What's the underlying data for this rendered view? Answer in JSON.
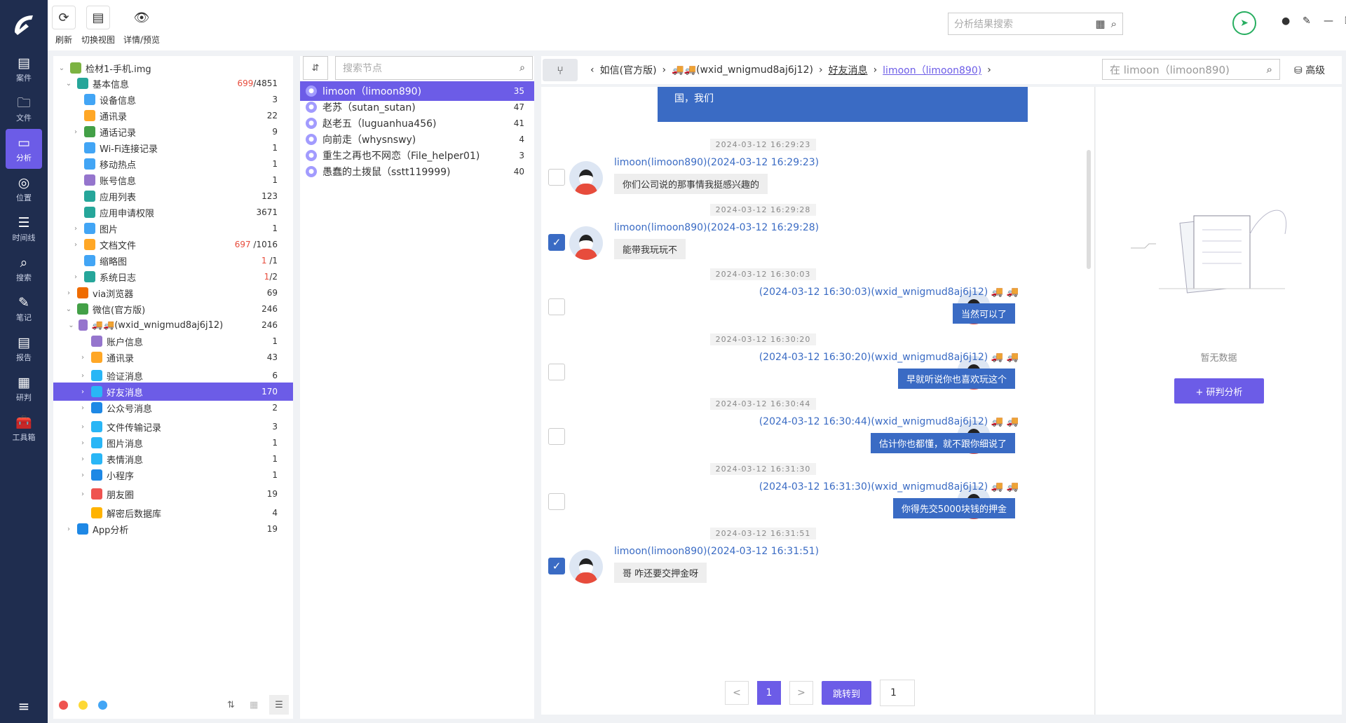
{
  "nav": {
    "items": [
      {
        "label": "案件",
        "icon": "case-icon"
      },
      {
        "label": "文件",
        "icon": "folder-icon"
      },
      {
        "label": "分析",
        "icon": "analysis-icon"
      },
      {
        "label": "位置",
        "icon": "location-icon"
      },
      {
        "label": "时间线",
        "icon": "timeline-icon"
      },
      {
        "label": "搜索",
        "icon": "search-icon"
      },
      {
        "label": "笔记",
        "icon": "note-icon"
      },
      {
        "label": "报告",
        "icon": "report-icon"
      },
      {
        "label": "研判",
        "icon": "judge-icon"
      },
      {
        "label": "工具箱",
        "icon": "toolbox-icon"
      }
    ],
    "active_index": 2
  },
  "toolbar": {
    "refresh": "刷新",
    "switch_view": "切换视图",
    "detail": "详情/预览"
  },
  "global_search": {
    "placeholder": "分析结果搜索"
  },
  "tree": {
    "rows": [
      {
        "label": "检材1-手机.img",
        "count": "",
        "count_red": "",
        "level": 0,
        "arrow": "v",
        "color": "#7cb342"
      },
      {
        "label": "基本信息",
        "count": "/4851",
        "count_red": "699",
        "level": 1,
        "arrow": "v",
        "color": "#26a69a"
      },
      {
        "label": "设备信息",
        "count": "3",
        "count_red": "",
        "level": 2,
        "arrow": "",
        "color": "#42a5f5"
      },
      {
        "label": "通讯录",
        "count": "22",
        "count_red": "",
        "level": 2,
        "arrow": "",
        "color": "#ffa726"
      },
      {
        "label": "通话记录",
        "count": "9",
        "count_red": "",
        "level": 2,
        "arrow": ">",
        "color": "#43a047"
      },
      {
        "label": "Wi-Fi连接记录",
        "count": "1",
        "count_red": "",
        "level": 2,
        "arrow": "",
        "color": "#42a5f5"
      },
      {
        "label": "移动热点",
        "count": "1",
        "count_red": "",
        "level": 2,
        "arrow": "",
        "color": "#42a5f5"
      },
      {
        "label": "账号信息",
        "count": "1",
        "count_red": "",
        "level": 2,
        "arrow": "",
        "color": "#9575cd"
      },
      {
        "label": "应用列表",
        "count": "123",
        "count_red": "",
        "level": 2,
        "arrow": "",
        "color": "#26a69a"
      },
      {
        "label": "应用申请权限",
        "count": "3671",
        "count_red": "",
        "level": 2,
        "arrow": "",
        "color": "#26a69a"
      },
      {
        "label": "图片",
        "count": "1",
        "count_red": "",
        "level": 2,
        "arrow": ">",
        "color": "#42a5f5"
      },
      {
        "label": "文档文件",
        "count": " /1016",
        "count_red": "697",
        "level": 2,
        "arrow": ">",
        "color": "#ffa726"
      },
      {
        "label": "缩略图",
        "count": " /1",
        "count_red": "1",
        "level": 2,
        "arrow": "",
        "color": "#42a5f5"
      },
      {
        "label": "系统日志",
        "count": "/2",
        "count_red": "1",
        "level": 2,
        "arrow": ">",
        "color": "#26a69a"
      },
      {
        "label": "via浏览器",
        "count": "69",
        "count_red": "",
        "level": 1,
        "arrow": ">",
        "color": "#ef6c00"
      },
      {
        "label": "微信(官方版)",
        "count": "246",
        "count_red": "",
        "level": 1,
        "arrow": "v",
        "color": "#43a047"
      },
      {
        "label": "🚚🚚(wxid_wnigmud8aj6j12)",
        "count": "246",
        "count_red": "",
        "level": 2,
        "arrow": "v",
        "color": "#9575cd"
      },
      {
        "label": "账户信息",
        "count": "1",
        "count_red": "",
        "level": 3,
        "arrow": "",
        "color": "#9575cd"
      },
      {
        "label": "通讯录",
        "count": "43",
        "count_red": "",
        "level": 3,
        "arrow": ">",
        "color": "#ffa726"
      },
      {
        "label": "验证消息",
        "count": "6",
        "count_red": "",
        "level": 3,
        "arrow": ">",
        "color": "#29b6f6"
      },
      {
        "label": "好友消息",
        "count": "170",
        "count_red": "",
        "level": 3,
        "arrow": ">",
        "color": "#29b6f6",
        "selected": true
      },
      {
        "label": "公众号消息",
        "count": "2",
        "count_red": "",
        "level": 3,
        "arrow": ">",
        "color": "#1e88e5"
      },
      {
        "label": "文件传输记录",
        "count": "3",
        "count_red": "",
        "level": 3,
        "arrow": ">",
        "color": "#29b6f6"
      },
      {
        "label": "图片消息",
        "count": "1",
        "count_red": "",
        "level": 3,
        "arrow": ">",
        "color": "#29b6f6"
      },
      {
        "label": "表情消息",
        "count": "1",
        "count_red": "",
        "level": 3,
        "arrow": ">",
        "color": "#29b6f6"
      },
      {
        "label": "小程序",
        "count": "1",
        "count_red": "",
        "level": 3,
        "arrow": ">",
        "color": "#1e88e5"
      },
      {
        "label": "朋友圈",
        "count": "19",
        "count_red": "",
        "level": 3,
        "arrow": ">",
        "color": "#ef5350"
      },
      {
        "label": "解密后数据库",
        "count": "4",
        "count_red": "",
        "level": 3,
        "arrow": "",
        "color": "#ffb300"
      },
      {
        "label": "App分析",
        "count": "19",
        "count_red": "",
        "level": 1,
        "arrow": ">",
        "color": "#1e88e5"
      }
    ]
  },
  "list": {
    "search_placeholder": "搜索节点",
    "rows": [
      {
        "name": "limoon（limoon890)",
        "count": "35",
        "selected": true
      },
      {
        "name": "老苏（sutan_sutan)",
        "count": "47"
      },
      {
        "name": "赵老五（luguanhua456)",
        "count": "41"
      },
      {
        "name": "向前走（whysnswy)",
        "count": "4"
      },
      {
        "name": "重生之再也不网恋（File_helper01)",
        "count": "3"
      },
      {
        "name": "愚蠢的土拨鼠（sstt119999)",
        "count": "40"
      }
    ]
  },
  "breadcrumb": {
    "c1": "如信(官方版)",
    "c2": "🚚🚚(wxid_wnigmud8aj6j12)",
    "c3": "好友消息",
    "c4": "limoon（limoon890)",
    "search_placeholder": "在 limoon（limoon890)",
    "advanced": "高级"
  },
  "chat": {
    "top_bubble": "国，我们",
    "messages": [
      {
        "time": "2024-03-12 16:29:23",
        "side": "left",
        "sender": "limoon(limoon890)(2024-03-12 16:29:23)",
        "text": "你们公司说的那事情我挺感兴趣的",
        "checked": false
      },
      {
        "time": "2024-03-12 16:29:28",
        "side": "left",
        "sender": "limoon(limoon890)(2024-03-12 16:29:28)",
        "text": "能带我玩玩不",
        "checked": true
      },
      {
        "time": "2024-03-12 16:30:03",
        "side": "right",
        "sender": "(2024-03-12 16:30:03)(wxid_wnigmud8aj6j12) 🚚 🚚",
        "text": "当然可以了",
        "checked": false
      },
      {
        "time": "2024-03-12 16:30:20",
        "side": "right",
        "sender": "(2024-03-12 16:30:20)(wxid_wnigmud8aj6j12) 🚚 🚚",
        "text": "早就听说你也喜欢玩这个",
        "checked": false
      },
      {
        "time": "2024-03-12 16:30:44",
        "side": "right",
        "sender": "(2024-03-12 16:30:44)(wxid_wnigmud8aj6j12) 🚚 🚚",
        "text": "估计你也都懂，就不跟你细说了",
        "checked": false
      },
      {
        "time": "2024-03-12 16:31:30",
        "side": "right",
        "sender": "(2024-03-12 16:31:30)(wxid_wnigmud8aj6j12) 🚚 🚚",
        "text": "你得先交5000块钱的押金",
        "checked": false
      },
      {
        "time": "2024-03-12 16:31:51",
        "side": "left",
        "sender": "limoon(limoon890)(2024-03-12 16:31:51)",
        "text": "哥  咋还要交押金呀",
        "checked": true
      }
    ],
    "pager": {
      "prev": "<",
      "page": "1",
      "next": ">",
      "jump": "跳转到",
      "input": "1"
    }
  },
  "right": {
    "empty": "暂无数据",
    "button": "+ 研判分析"
  }
}
